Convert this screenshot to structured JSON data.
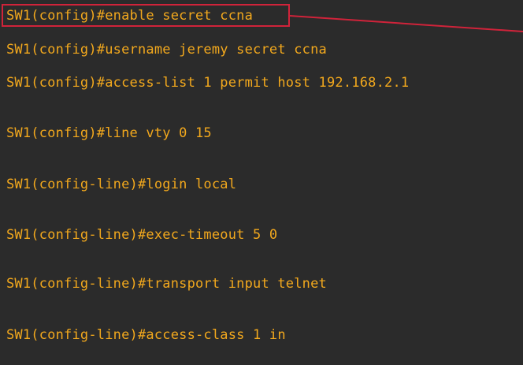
{
  "terminal": {
    "lines": [
      "SW1(config)#enable secret ccna",
      "SW1(config)#username jeremy secret ccna",
      "SW1(config)#access-list 1 permit host 192.168.2.1",
      "SW1(config)#line vty 0 15",
      "SW1(config-line)#login local",
      "SW1(config-line)#exec-timeout 5 0",
      "SW1(config-line)#transport input telnet",
      "SW1(config-line)#access-class 1 in"
    ]
  },
  "colors": {
    "background": "#2b2b2b",
    "text": "#f2a81d",
    "highlight": "#d0233a"
  }
}
